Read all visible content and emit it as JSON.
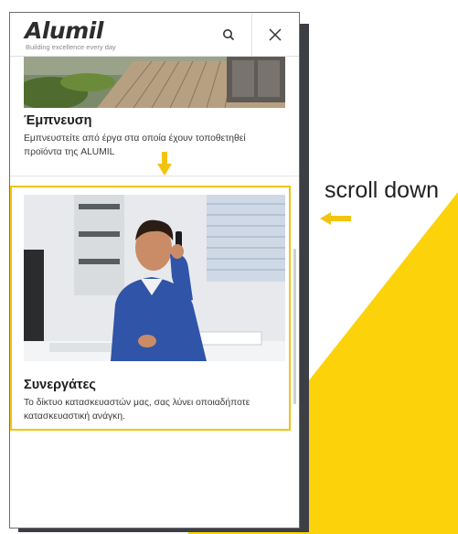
{
  "header": {
    "logo": "Alumil",
    "tagline": "Building excellence every day"
  },
  "sections": [
    {
      "title": "Έμπνευση",
      "description": "Εμπνευστείτε από έργα στα οποία έχουν τοποθετηθεί προϊόντα της ALUMIL"
    },
    {
      "title": "Συνεργάτες",
      "description": "Το δίκτυο κατασκευαστών μας, σας λύνει οποιαδήποτε κατασκευαστική ανάγκη."
    }
  ],
  "annotation": {
    "label": "scroll down"
  },
  "colors": {
    "accent": "#f3c40f",
    "shadow": "#3c3f44",
    "text": "#1d1d1d"
  },
  "icons": [
    "search-icon",
    "close-icon",
    "arrow-down-icon",
    "arrow-left-icon"
  ]
}
